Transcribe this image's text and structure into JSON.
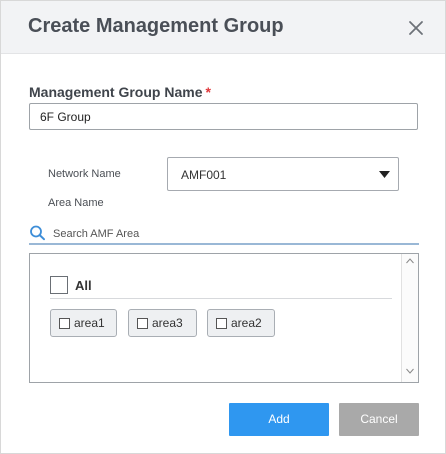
{
  "dialog": {
    "title": "Create Management Group",
    "close_icon": "close-icon"
  },
  "form": {
    "group_name_label": "Management Group Name",
    "required_marker": "*",
    "group_name_value": "6F Group",
    "network_name_label": "Network Name",
    "network_name_selected": "AMF001",
    "area_name_label": "Area Name",
    "search_placeholder": "Search AMF Area"
  },
  "area_list": {
    "all_label": "All",
    "areas": [
      {
        "label": "area1",
        "checked": false
      },
      {
        "label": "area3",
        "checked": false
      },
      {
        "label": "area2",
        "checked": false
      }
    ]
  },
  "buttons": {
    "add_label": "Add",
    "cancel_label": "Cancel"
  },
  "colors": {
    "primary": "#2f97f0",
    "cancel": "#a9a9a9",
    "required": "#e0383b",
    "header_bg": "#f2f3f5"
  }
}
